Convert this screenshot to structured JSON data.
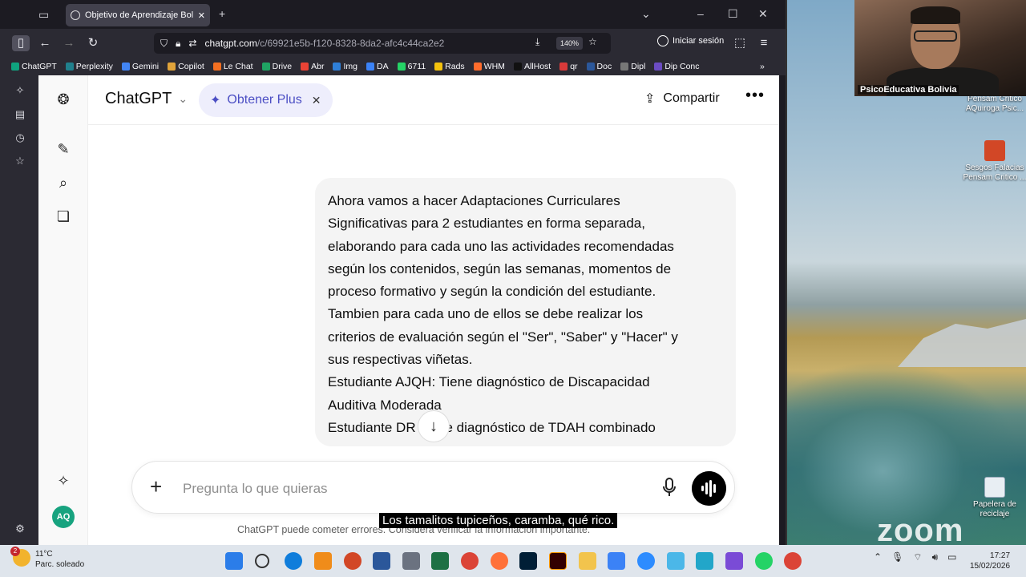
{
  "browser": {
    "tab_title": "Objetivo de Aprendizaje Bolivia",
    "url_main": "chatgpt.com",
    "url_rest": "/c/69921e5b-f120-8328-8da2-afc4c44ca2e2",
    "zoom_level": "140%",
    "signin_label": "Iniciar sesión",
    "bookmarks": [
      "ChatGPT",
      "Perplexity",
      "Gemini",
      "Copilot",
      "Le Chat",
      "Drive",
      "Abr",
      "Img",
      "DA",
      "6711",
      "Rads",
      "WHM",
      "AllHost",
      "qr",
      "Doc",
      "Dipl",
      "Dip Conc"
    ]
  },
  "chatgpt": {
    "model_name": "ChatGPT",
    "plus_label": "Obtener Plus",
    "share_label": "Compartir",
    "user_message": [
      "Ahora vamos a hacer Adaptaciones Curriculares",
      "Significativas para 2 estudiantes en forma separada,",
      "elaborando para cada uno las actividades recomendadas",
      "según los contenidos, según las semanas, momentos de",
      "proceso formativo y según la condición del estudiante.",
      "Tambien para cada uno de ellos se debe realizar los",
      "criterios de evaluación según el \"Ser\", \"Saber\" y \"Hacer\" y",
      "sus respectivas viñetas.",
      "Estudiante AJQH: Tiene diagnóstico de Discapacidad",
      "Auditiva Moderada",
      "Estudiante DR Tiene diagnóstico de TDAH combinado"
    ],
    "composer_placeholder": "Pregunta lo que quieras",
    "disclaimer": "ChatGPT puede cometer errores. Considera verificar la información importante.",
    "avatar_initials": "AQ"
  },
  "zoom": {
    "participant_name": "PsicoEducativa Bolivia",
    "caption": "Los tamalitos tupiceños, caramba, qué rico.",
    "logo": "zoom"
  },
  "desktop": {
    "icon1_label": "Pensam Critico AQuiroga Psic...",
    "icon2_label": "Sesgos Falacias Pensam Critico ...",
    "icon3_label": "Papelera de reciclaje"
  },
  "taskbar": {
    "temperature": "11°C",
    "weather": "Parc. soleado",
    "notification_count": "2",
    "time": "17:27",
    "date": "15/02/2026"
  },
  "colors": {
    "accent_plus": "#4b4ec4",
    "avatar_bg": "#17a37f"
  }
}
